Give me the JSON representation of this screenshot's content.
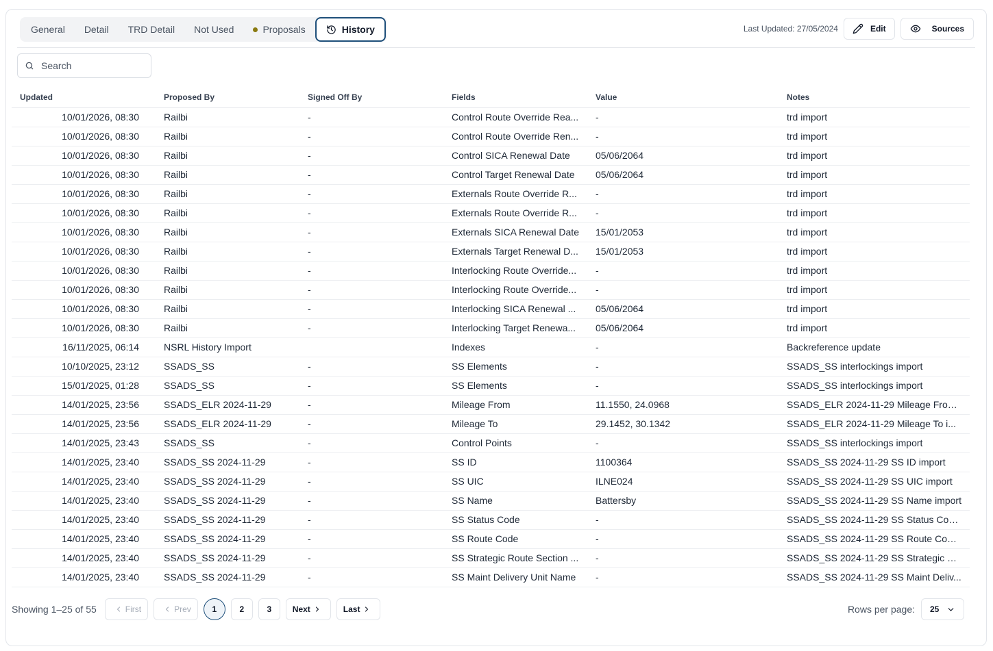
{
  "tabs": [
    {
      "label": "General",
      "active": false,
      "dot": false
    },
    {
      "label": "Detail",
      "active": false,
      "dot": false
    },
    {
      "label": "TRD Detail",
      "active": false,
      "dot": false
    },
    {
      "label": "Not Used",
      "active": false,
      "dot": false
    },
    {
      "label": "Proposals",
      "active": false,
      "dot": true
    },
    {
      "label": "History",
      "active": true,
      "dot": false,
      "icon": "history-icon"
    }
  ],
  "header": {
    "last_updated": "Last Updated: 27/05/2024",
    "edit_label": "Edit",
    "sources_label": "Sources"
  },
  "search": {
    "placeholder": "Search",
    "value": ""
  },
  "table": {
    "columns": [
      "Updated",
      "Proposed By",
      "Signed Off By",
      "Fields",
      "Value",
      "Notes"
    ],
    "rows": [
      [
        "10/01/2026, 08:30",
        "Railbi",
        "-",
        "Control Route Override Rea...",
        "-",
        "trd import"
      ],
      [
        "10/01/2026, 08:30",
        "Railbi",
        "-",
        "Control Route Override Ren...",
        "-",
        "trd import"
      ],
      [
        "10/01/2026, 08:30",
        "Railbi",
        "-",
        "Control SICA Renewal Date",
        "05/06/2064",
        "trd import"
      ],
      [
        "10/01/2026, 08:30",
        "Railbi",
        "-",
        "Control Target Renewal Date",
        "05/06/2064",
        "trd import"
      ],
      [
        "10/01/2026, 08:30",
        "Railbi",
        "-",
        "Externals Route Override R...",
        "-",
        "trd import"
      ],
      [
        "10/01/2026, 08:30",
        "Railbi",
        "-",
        "Externals Route Override R...",
        "-",
        "trd import"
      ],
      [
        "10/01/2026, 08:30",
        "Railbi",
        "-",
        "Externals SICA Renewal Date",
        "15/01/2053",
        "trd import"
      ],
      [
        "10/01/2026, 08:30",
        "Railbi",
        "-",
        "Externals Target Renewal D...",
        "15/01/2053",
        "trd import"
      ],
      [
        "10/01/2026, 08:30",
        "Railbi",
        "-",
        "Interlocking Route Override...",
        "-",
        "trd import"
      ],
      [
        "10/01/2026, 08:30",
        "Railbi",
        "-",
        "Interlocking Route Override...",
        "-",
        "trd import"
      ],
      [
        "10/01/2026, 08:30",
        "Railbi",
        "-",
        "Interlocking SICA Renewal ...",
        "05/06/2064",
        "trd import"
      ],
      [
        "10/01/2026, 08:30",
        "Railbi",
        "-",
        "Interlocking Target Renewa...",
        "05/06/2064",
        "trd import"
      ],
      [
        "16/11/2025, 06:14",
        "NSRL History Import",
        "",
        "Indexes",
        "-",
        "Backreference update"
      ],
      [
        "10/10/2025, 23:12",
        "SSADS_SS",
        "-",
        "SS Elements",
        "-",
        "SSADS_SS interlockings import"
      ],
      [
        "15/01/2025, 01:28",
        "SSADS_SS",
        "-",
        "SS Elements",
        "-",
        "SSADS_SS interlockings import"
      ],
      [
        "14/01/2025, 23:56",
        "SSADS_ELR 2024-11-29",
        "-",
        "Mileage From",
        "11.1550, 24.0968",
        "SSADS_ELR 2024-11-29 Mileage From..."
      ],
      [
        "14/01/2025, 23:56",
        "SSADS_ELR 2024-11-29",
        "-",
        "Mileage To",
        "29.1452, 30.1342",
        "SSADS_ELR 2024-11-29 Mileage To i..."
      ],
      [
        "14/01/2025, 23:43",
        "SSADS_SS",
        "-",
        "Control Points",
        "-",
        "SSADS_SS interlockings import"
      ],
      [
        "14/01/2025, 23:40",
        "SSADS_SS 2024-11-29",
        "-",
        "SS ID",
        "1100364",
        "SSADS_SS 2024-11-29 SS ID import"
      ],
      [
        "14/01/2025, 23:40",
        "SSADS_SS 2024-11-29",
        "-",
        "SS UIC",
        "ILNE024",
        "SSADS_SS 2024-11-29 SS UIC import"
      ],
      [
        "14/01/2025, 23:40",
        "SSADS_SS 2024-11-29",
        "-",
        "SS Name",
        "Battersby",
        "SSADS_SS 2024-11-29 SS Name import"
      ],
      [
        "14/01/2025, 23:40",
        "SSADS_SS 2024-11-29",
        "-",
        "SS Status Code",
        "-",
        "SSADS_SS 2024-11-29 SS Status Cod..."
      ],
      [
        "14/01/2025, 23:40",
        "SSADS_SS 2024-11-29",
        "-",
        "SS Route Code",
        "-",
        "SSADS_SS 2024-11-29 SS Route Code..."
      ],
      [
        "14/01/2025, 23:40",
        "SSADS_SS 2024-11-29",
        "-",
        "SS Strategic Route Section ...",
        "-",
        "SSADS_SS 2024-11-29 SS Strategic R..."
      ],
      [
        "14/01/2025, 23:40",
        "SSADS_SS 2024-11-29",
        "-",
        "SS Maint Delivery Unit Name",
        "-",
        "SSADS_SS 2024-11-29 SS Maint Deliv..."
      ]
    ]
  },
  "pagination": {
    "showing": "Showing 1–25 of 55",
    "first": "First",
    "prev": "Prev",
    "pages": [
      "1",
      "2",
      "3"
    ],
    "current_page": "1",
    "next": "Next",
    "last": "Last",
    "rows_per_page_label": "Rows per page:",
    "rows_per_page_value": "25"
  },
  "colors": {
    "accent": "#1e4f7a",
    "proposal_dot": "#8a7a10"
  }
}
